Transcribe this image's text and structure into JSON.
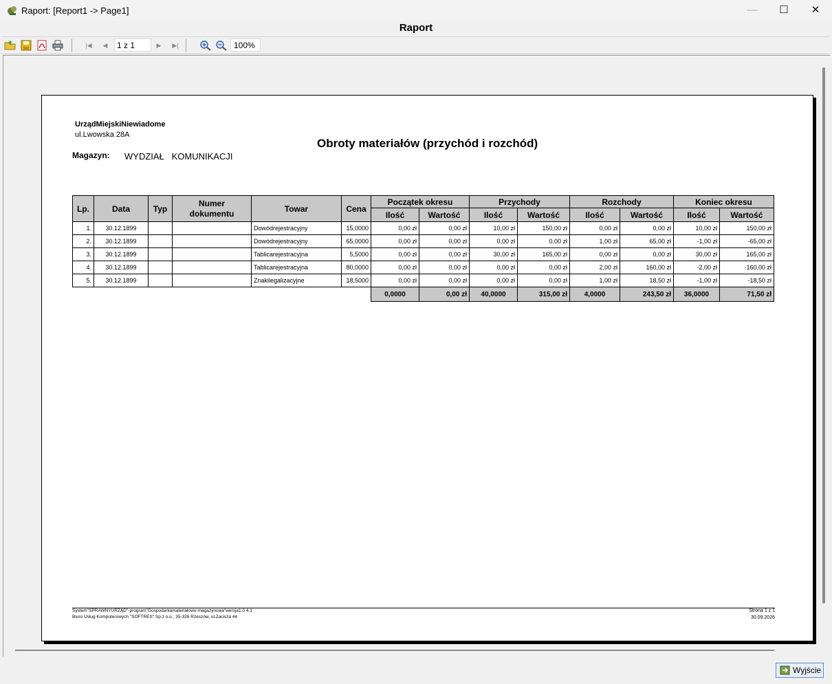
{
  "window": {
    "title": "Raport: [Report1 -> Page1]",
    "minimize_glyph": "—",
    "maximize_glyph": "☐",
    "close_glyph": "✕"
  },
  "caption": "Raport",
  "toolbar": {
    "page_indicator": "1 z 1",
    "zoom": "100%",
    "icons": [
      "open-folder-icon",
      "save-icon",
      "pdf-icon",
      "print-icon",
      "first-page-icon",
      "prev-page-icon",
      "next-page-icon",
      "last-page-icon",
      "zoom-in-icon",
      "zoom-out-icon"
    ]
  },
  "report": {
    "org_name": "UrządMiejskiNiewiadome",
    "org_address": "ul.Lwowska 28A",
    "title": "Obroty materiałów (przychód i rozchód)",
    "warehouse_label": "Magazyn:",
    "warehouse_value": "WYDZIAŁ   KOMUNIKACJI",
    "headers": {
      "lp": "Lp.",
      "date": "Data",
      "type": "Typ",
      "doc_number_line1": "Numer",
      "doc_number_line2": "dokumentu",
      "item": "Towar",
      "price": "Cena",
      "groups": [
        "Początek okresu",
        "Przychody",
        "Rozchody",
        "Koniec okresu"
      ],
      "qty": "Ilość",
      "value": "Wartość"
    },
    "rows": [
      {
        "lp": "1.",
        "date": "30.12.1899",
        "type": "",
        "doc": "",
        "item": "Dowódrejestracyjny",
        "price": "15,0000",
        "start_qty": "0,00 zł",
        "start_val": "0,00 zł",
        "in_qty": "10,00 zł",
        "in_val": "150,00 zł",
        "out_qty": "0,00 zł",
        "out_val": "0,00 zł",
        "end_qty": "10,00 zł",
        "end_val": "150,00 zł"
      },
      {
        "lp": "2.",
        "date": "30.12.1899",
        "type": "",
        "doc": "",
        "item": "Dowódrejestracyjny",
        "price": "65,0000",
        "start_qty": "0,00 zł",
        "start_val": "0,00 zł",
        "in_qty": "0,00 zł",
        "in_val": "0,00 zł",
        "out_qty": "1,00 zł",
        "out_val": "65,00 zł",
        "end_qty": "-1,00 zł",
        "end_val": "-65,00 zł"
      },
      {
        "lp": "3.",
        "date": "30.12.1899",
        "type": "",
        "doc": "",
        "item": "Tablicarejestracyjna",
        "price": "5,5000",
        "start_qty": "0,00 zł",
        "start_val": "0,00 zł",
        "in_qty": "30,00 zł",
        "in_val": "165,00 zł",
        "out_qty": "0,00 zł",
        "out_val": "0,00 zł",
        "end_qty": "30,00 zł",
        "end_val": "165,00 zł"
      },
      {
        "lp": "4.",
        "date": "30.12.1899",
        "type": "",
        "doc": "",
        "item": "Tablicarejestracyjna",
        "price": "80,0000",
        "start_qty": "0,00 zł",
        "start_val": "0,00 zł",
        "in_qty": "0,00 zł",
        "in_val": "0,00 zł",
        "out_qty": "2,00 zł",
        "out_val": "160,00 zł",
        "end_qty": "-2,00 zł",
        "end_val": "-160,00 zł"
      },
      {
        "lp": "5.",
        "date": "30.12.1899",
        "type": "",
        "doc": "",
        "item": "Znakilegalizacyjne",
        "price": "18,5000",
        "start_qty": "0,00 zł",
        "start_val": "0,00 zł",
        "in_qty": "0,00 zł",
        "in_val": "0,00 zł",
        "out_qty": "1,00 zł",
        "out_val": "18,50 zł",
        "end_qty": "-1,00 zł",
        "end_val": "-18,50 zł"
      }
    ],
    "totals": {
      "start_qty": "0,0000",
      "start_val": "0,00 zł",
      "in_qty": "40,0000",
      "in_val": "315,00 zł",
      "out_qty": "4,0000",
      "out_val": "243,50 zł",
      "end_qty": "36,0000",
      "end_val": "71,50 zł"
    },
    "footer": {
      "line1": "System\"SPRAWNYURZĄD\"-program\"Gospodarkamateriałowo-magazynowa\"wersja1.0.4.1",
      "line2": "Biuro Usług Komputerowych \"SOFTRES\" Sp.z o.o., 35-326 Rzeszów, ul.Zacisza 44",
      "page": "Strona 1 z 1",
      "date": "30.09.2026"
    }
  },
  "exit_button_label": "Wyjście"
}
